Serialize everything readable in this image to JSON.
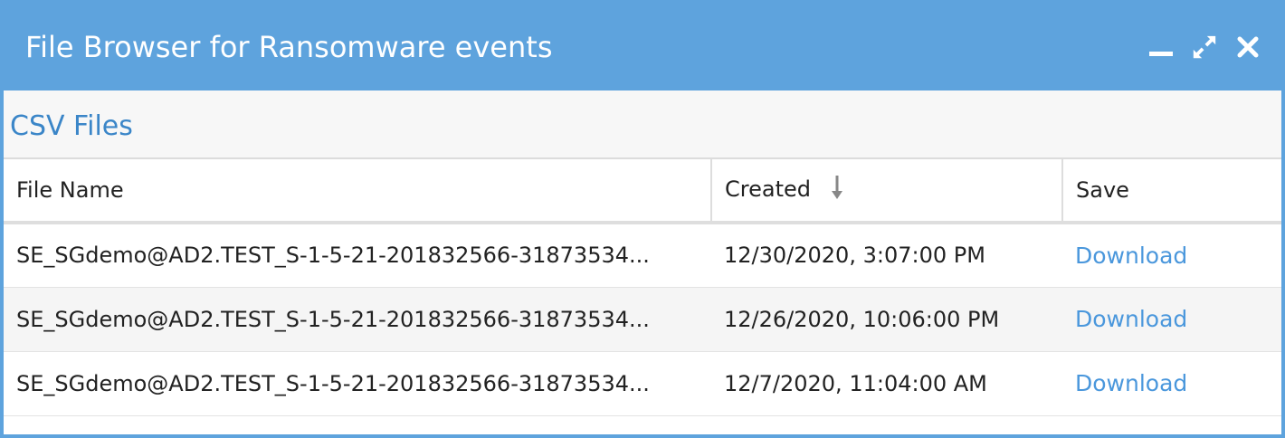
{
  "window": {
    "title": "File Browser for Ransomware events",
    "accent_color": "#5ea3dd",
    "controls": [
      "minimize-icon",
      "expand-icon",
      "close-icon"
    ]
  },
  "section": {
    "title": "CSV Files",
    "title_color": "#3b86c8"
  },
  "table": {
    "columns": [
      "File Name",
      "Created",
      "Save"
    ],
    "sort": {
      "column": "Created",
      "direction": "descending",
      "icon": "sort-down-arrow-icon"
    },
    "rows": [
      {
        "file_name": "SE_SGdemo@AD2.TEST_S-1-5-21-201832566-31873534...",
        "created": "12/30/2020, 3:07:00 PM",
        "save": "Download"
      },
      {
        "file_name": "SE_SGdemo@AD2.TEST_S-1-5-21-201832566-31873534...",
        "created": "12/26/2020, 10:06:00 PM",
        "save": "Download"
      },
      {
        "file_name": "SE_SGdemo@AD2.TEST_S-1-5-21-201832566-31873534...",
        "created": "12/7/2020, 11:04:00 AM",
        "save": "Download"
      }
    ],
    "link_color": "#4a97dc"
  }
}
